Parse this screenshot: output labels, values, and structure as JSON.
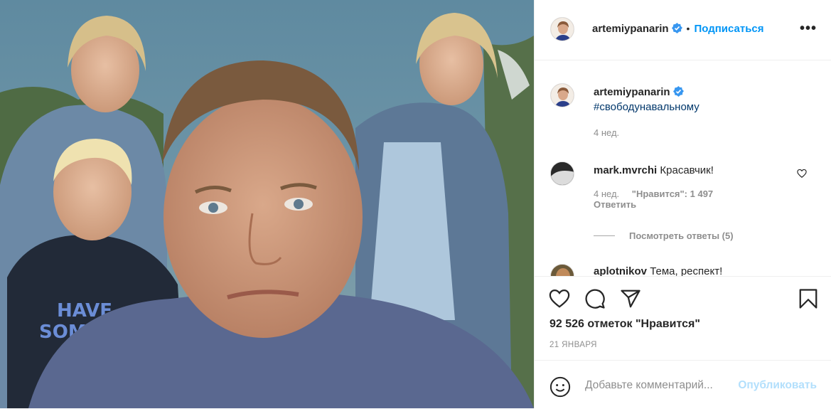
{
  "post": {
    "author": "artemiypanarin",
    "follow_label": "Подписаться",
    "dot": "•",
    "more_label": "•••"
  },
  "caption": {
    "username": "artemiypanarin",
    "text": "#свободунавальному",
    "time": "4 нед."
  },
  "comments": [
    {
      "username": "mark.mvrchi",
      "text": "Красавчик!",
      "time": "4 нед.",
      "likes": "\"Нравится\": 1 497",
      "reply_label": "Ответить",
      "view_replies": "Посмотреть ответы (5)"
    },
    {
      "username": "aplotnikov",
      "text": "Тема, респект!"
    }
  ],
  "likes_count": "92 526 отметок \"Нравится\"",
  "date": "21 ЯНВАРЯ",
  "composer": {
    "placeholder": "Добавьте комментарий...",
    "publish_label": "Опубликовать"
  },
  "colors": {
    "accent": "#0095f6",
    "verified": "#3897f0",
    "publish_disabled": "#b2dffc"
  }
}
